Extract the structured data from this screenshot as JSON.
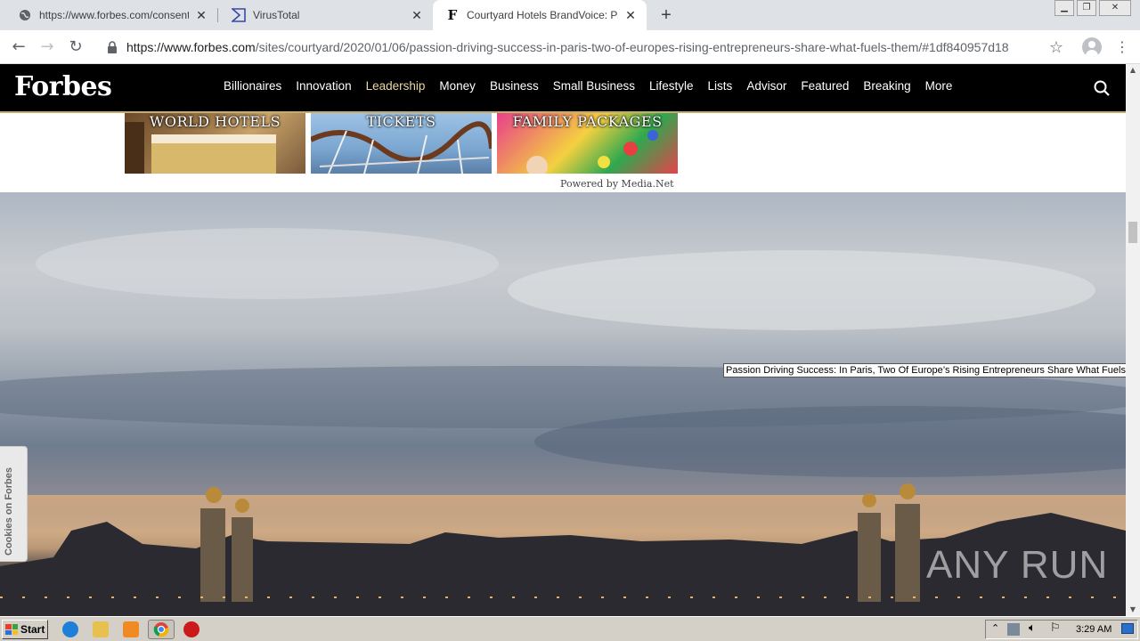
{
  "tabs": [
    {
      "title": "https://www.forbes.com/consent/?t",
      "icon": "globe-icon",
      "active": false
    },
    {
      "title": "VirusTotal",
      "icon": "virustotal-icon",
      "active": false
    },
    {
      "title": "Courtyard Hotels BrandVoice: Passio",
      "icon": "forbes-f-icon",
      "active": true
    }
  ],
  "toolbar": {
    "url_host": "https://www.forbes.com",
    "url_path": "/sites/courtyard/2020/01/06/passion-driving-success-in-paris-two-of-europes-rising-entrepreneurs-share-what-fuels-them/#1df840957d18"
  },
  "forbes": {
    "logo": "Forbes",
    "menu": [
      "Billionaires",
      "Innovation",
      "Leadership",
      "Money",
      "Business",
      "Small Business",
      "Lifestyle",
      "Lists",
      "Advisor",
      "Featured",
      "Breaking",
      "More"
    ],
    "active_menu": "Leadership"
  },
  "ads": {
    "tiles": [
      "WORLD HOTELS",
      "TICKETS",
      "FAMILY PACKAGES"
    ],
    "powered_by": "Powered by Media.Net"
  },
  "hero": {
    "tooltip": "Passion Driving Success: In Paris, Two Of Europe’s Rising Entrepreneurs Share What Fuels Them",
    "cookies_label": "Cookies on Forbes",
    "watermark": "ANY RUN"
  },
  "taskbar": {
    "start_label": "Start",
    "clock": "3:29 AM"
  },
  "colors": {
    "forbes_nav_bg": "#000000",
    "forbes_accent": "#c5ad6e",
    "tabstrip_bg": "#dee1e6"
  }
}
